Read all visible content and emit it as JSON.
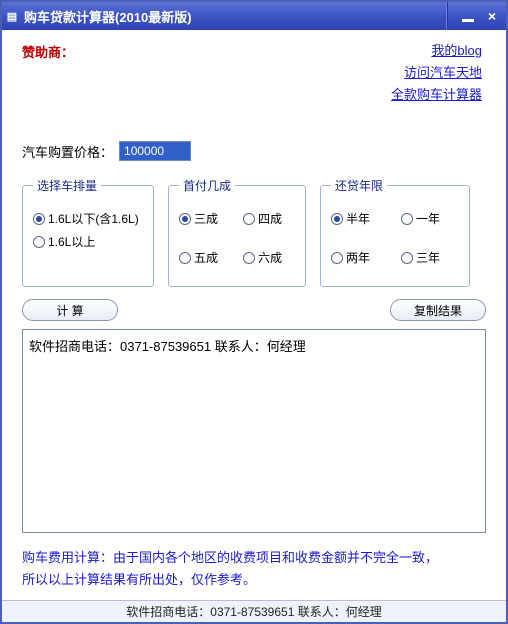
{
  "window": {
    "title": "购车贷款计算器(2010最新版)"
  },
  "sponsor_label": "赞助商：",
  "links": {
    "blog": "我的blog",
    "car_world": "访问汽车天地",
    "full_calc": "全款购车计算器"
  },
  "price": {
    "label": "汽车购置价格：",
    "value": "100000"
  },
  "groups": {
    "engine": {
      "legend": "选择车排量",
      "opt_below": "1.6L以下(含1.6L)",
      "opt_above": "1.6L以上",
      "selected": "below"
    },
    "downpay": {
      "legend": "首付几成",
      "opt_3": "三成",
      "opt_4": "四成",
      "opt_5": "五成",
      "opt_6": "六成",
      "selected": "3"
    },
    "term": {
      "legend": "还贷年限",
      "opt_half": "半年",
      "opt_1": "一年",
      "opt_2": "两年",
      "opt_3": "三年",
      "selected": "half"
    }
  },
  "buttons": {
    "calc": "计 算",
    "copy": "复制结果"
  },
  "result_text": "软件招商电话：0371-87539651 联系人：何经理",
  "footnote_line1": "购车费用计算：由于国内各个地区的收费项目和收费金额并不完全一致，",
  "footnote_line2": "所以以上计算结果有所出处，仅作参考。",
  "statusbar": "软件招商电话：0371-87539651 联系人：何经理"
}
